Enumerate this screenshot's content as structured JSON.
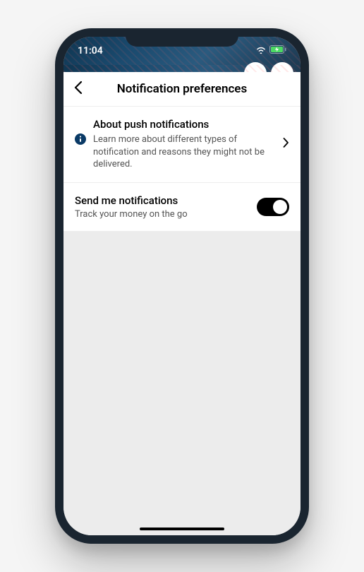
{
  "statusBar": {
    "time": "11:04"
  },
  "header": {
    "title": "Notification preferences"
  },
  "about": {
    "title": "About push notifications",
    "description": "Learn more about different types of notification and reasons they might not be delivered."
  },
  "toggle": {
    "title": "Send me notifications",
    "description": "Track your money on the go",
    "on": true
  }
}
